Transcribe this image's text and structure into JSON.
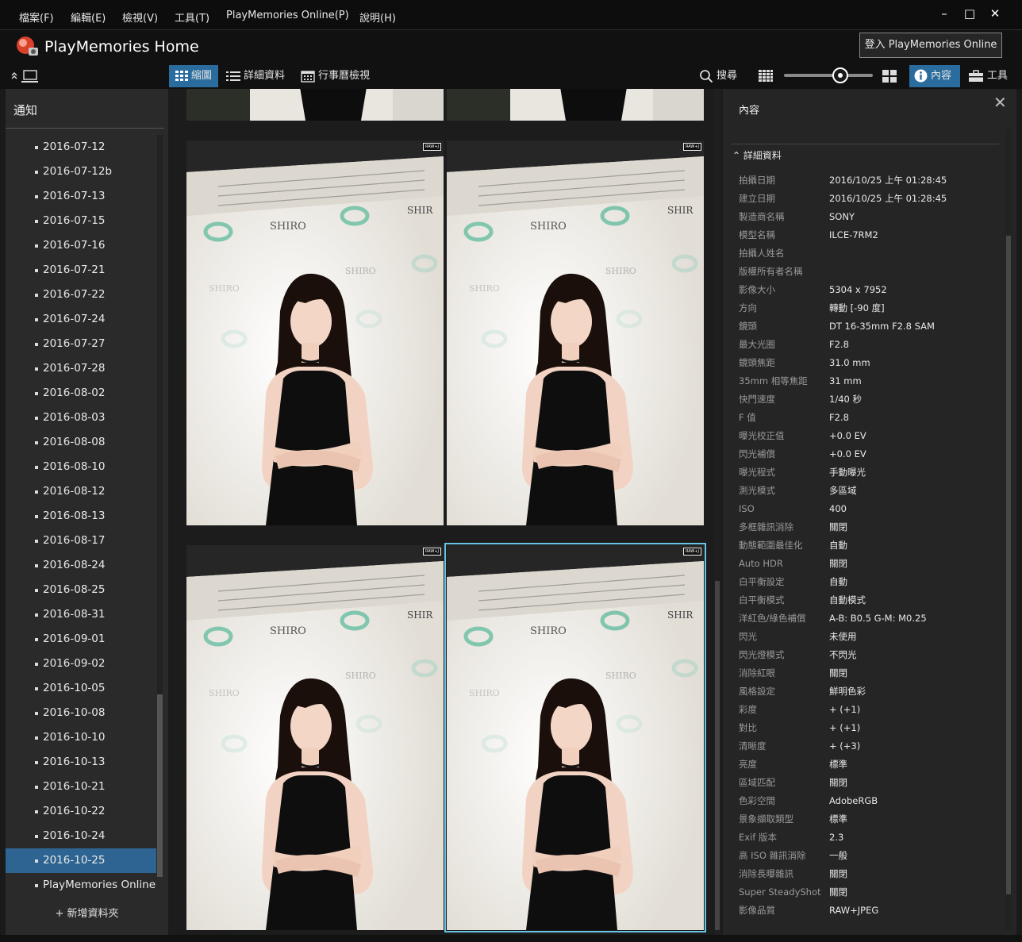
{
  "menu": {
    "items": [
      "檔案(F)",
      "編輯(E)",
      "檢視(V)",
      "工具(T)",
      "PlayMemories Online(P)",
      "說明(H)"
    ],
    "minimize": "–",
    "maximize": "□",
    "close": "✕"
  },
  "app": {
    "title": "PlayMemories Home",
    "login_button": "登入 PlayMemories Online"
  },
  "toolbar": {
    "thumbnail_view": "縮圖",
    "details_view": "詳細資料",
    "calendar_view": "行事曆檢視",
    "search": "搜尋",
    "info": "內容",
    "tools": "工具",
    "zoom_fraction": 0.6
  },
  "left_panel": {
    "header": "通知",
    "folders": [
      "2016-07-12",
      "2016-07-12b",
      "2016-07-13",
      "2016-07-15",
      "2016-07-16",
      "2016-07-21",
      "2016-07-22",
      "2016-07-24",
      "2016-07-27",
      "2016-07-28",
      "2016-08-02",
      "2016-08-03",
      "2016-08-08",
      "2016-08-10",
      "2016-08-12",
      "2016-08-13",
      "2016-08-17",
      "2016-08-24",
      "2016-08-25",
      "2016-08-31",
      "2016-09-01",
      "2016-09-02",
      "2016-10-05",
      "2016-10-08",
      "2016-10-10",
      "2016-10-13",
      "2016-10-21",
      "2016-10-22",
      "2016-10-24",
      "2016-10-25",
      "PlayMemories Online"
    ],
    "selected_index": 29,
    "new_folder": "+ 新增資料夾"
  },
  "thumbnails": {
    "badge": "RAW+J",
    "sign_text": "SHIRO",
    "count": 6,
    "selected_index": 3
  },
  "right_panel": {
    "header": "內容",
    "section": "詳細資料",
    "properties": [
      {
        "k": "拍攝日期",
        "v": "2016/10/25 上午 01:28:45"
      },
      {
        "k": "建立日期",
        "v": "2016/10/25 上午 01:28:45"
      },
      {
        "k": "製造商名稱",
        "v": "SONY"
      },
      {
        "k": "模型名稱",
        "v": "ILCE-7RM2"
      },
      {
        "k": "拍攝人姓名",
        "v": ""
      },
      {
        "k": "版權所有者名稱",
        "v": ""
      },
      {
        "k": "影像大小",
        "v": "5304 x 7952"
      },
      {
        "k": "方向",
        "v": "轉動 [-90 度]"
      },
      {
        "k": "鏡頭",
        "v": "DT 16-35mm F2.8 SAM"
      },
      {
        "k": "最大光圈",
        "v": "F2.8"
      },
      {
        "k": "鏡頭焦距",
        "v": "31.0 mm"
      },
      {
        "k": "35mm 相等焦距",
        "v": "31 mm"
      },
      {
        "k": "快門速度",
        "v": "1/40 秒"
      },
      {
        "k": "F 值",
        "v": "F2.8"
      },
      {
        "k": "曝光校正值",
        "v": "+0.0 EV"
      },
      {
        "k": "閃光補償",
        "v": "+0.0 EV"
      },
      {
        "k": "曝光程式",
        "v": "手動曝光"
      },
      {
        "k": "測光模式",
        "v": "多區域"
      },
      {
        "k": "ISO",
        "v": "400"
      },
      {
        "k": "多框雜訊消除",
        "v": "關閉"
      },
      {
        "k": "動態範圍最佳化",
        "v": "自動"
      },
      {
        "k": "Auto HDR",
        "v": "關閉"
      },
      {
        "k": "白平衡設定",
        "v": "自動"
      },
      {
        "k": "白平衡模式",
        "v": "自動模式"
      },
      {
        "k": "洋紅色/綠色補償",
        "v": "A-B: B0.5 G-M: M0.25"
      },
      {
        "k": "閃光",
        "v": "未使用"
      },
      {
        "k": "閃光燈模式",
        "v": "不閃光"
      },
      {
        "k": "消除紅眼",
        "v": "關閉"
      },
      {
        "k": "風格設定",
        "v": "鮮明色彩"
      },
      {
        "k": "彩度",
        "v": "+ (+1)"
      },
      {
        "k": "對比",
        "v": "+ (+1)"
      },
      {
        "k": "清晰度",
        "v": "+ (+3)"
      },
      {
        "k": "亮度",
        "v": "標準"
      },
      {
        "k": "區域匹配",
        "v": "關閉"
      },
      {
        "k": "色彩空間",
        "v": "AdobeRGB"
      },
      {
        "k": "景象擷取類型",
        "v": "標準"
      },
      {
        "k": "Exif 版本",
        "v": "2.3"
      },
      {
        "k": "高 ISO 雜訊消除",
        "v": "一般"
      },
      {
        "k": "消除長曝雜訊",
        "v": "關閉"
      },
      {
        "k": "Super SteadyShot",
        "v": "關閉"
      },
      {
        "k": "影像品質",
        "v": "RAW+JPEG"
      }
    ]
  },
  "colors": {
    "accent": "#2b6c9e",
    "selected_folder": "#2e6491",
    "selection_frame": "#67c4e6"
  }
}
